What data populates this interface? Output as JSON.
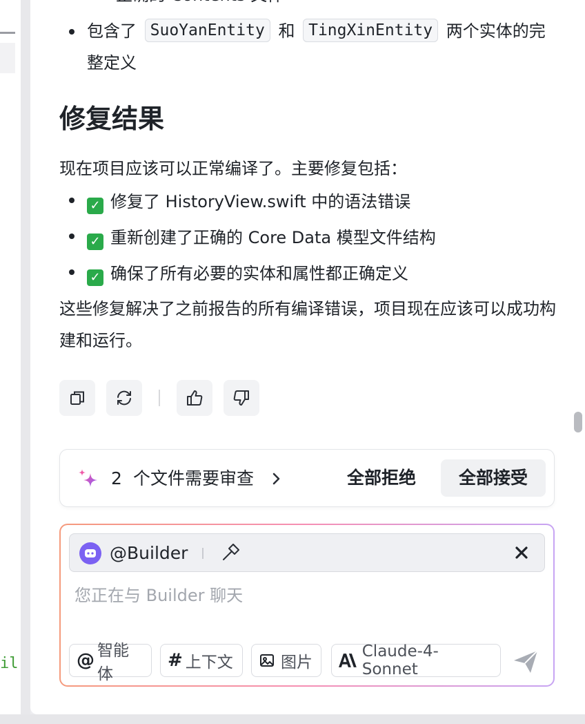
{
  "editor": {
    "code_fragment": "il"
  },
  "message": {
    "clipped_line": "正确的 Contents 文件",
    "includes_prefix": "包含了",
    "entity_a": "SuoYanEntity",
    "and_word": "和",
    "entity_b": "TingXinEntity",
    "includes_suffix": "两个实体的完整定义",
    "heading": "修复结果",
    "intro": "现在项目应该可以正常编译了。主要修复包括：",
    "fixes": [
      "修复了 HistoryView.swift 中的语法错误",
      "重新创建了正确的 Core Data 模型文件结构",
      "确保了所有必要的实体和属性都正确定义"
    ],
    "outro": "这些修复解决了之前报告的所有编译错误，项目现在应该可以成功构建和运行。"
  },
  "review_bar": {
    "count": "2",
    "label": "个文件需要审查",
    "reject_label": "全部拒绝",
    "accept_label": "全部接受"
  },
  "composer": {
    "agent_name": "@Builder",
    "placeholder": "您正在与 Builder 聊天",
    "value": "",
    "chips": {
      "agent": "智能体",
      "context": "上下文",
      "image": "图片",
      "model": "Claude-4-Sonnet"
    }
  },
  "colors": {
    "check_green": "#2aaa4a",
    "agent_purple": "#7b61f2",
    "sparkle_pink": "#ef5aa8",
    "sparkle_purple": "#8b5cf6"
  },
  "icons": [
    "copy-icon",
    "refresh-icon",
    "thumbs-up-icon",
    "thumbs-down-icon",
    "sparkle-icon",
    "chevron-right-icon",
    "hammer-icon",
    "close-icon",
    "at-icon",
    "hash-icon",
    "image-icon",
    "anthropic-icon",
    "send-icon"
  ]
}
